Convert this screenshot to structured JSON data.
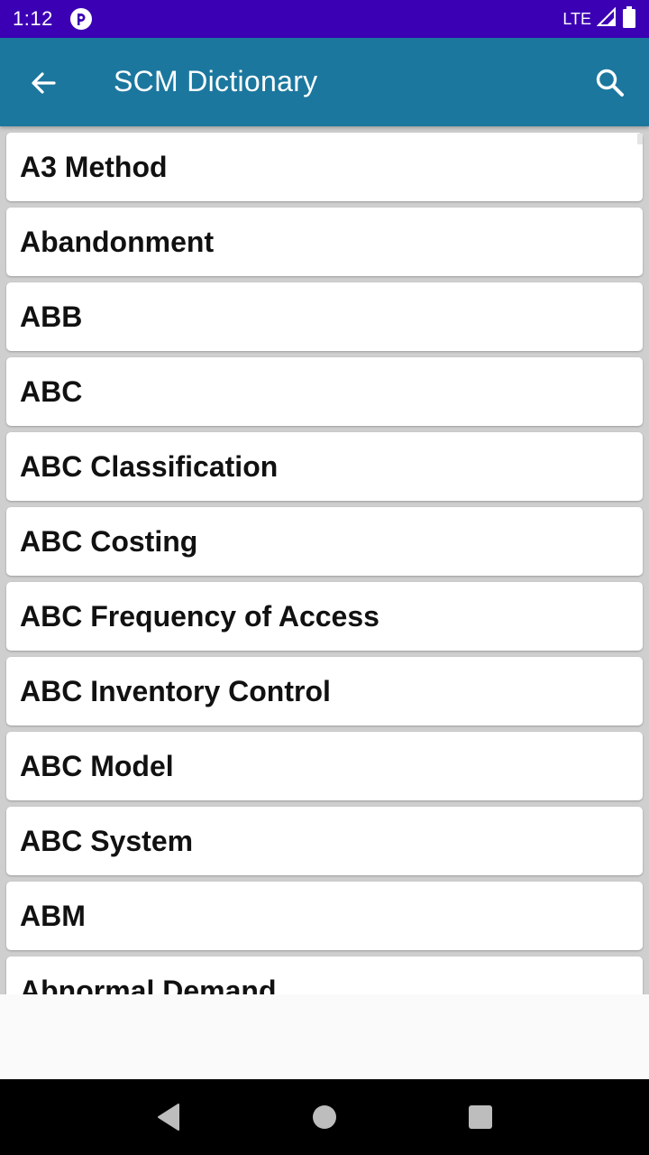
{
  "status_bar": {
    "time": "1:12",
    "network": "LTE",
    "icons": [
      "notification-app-icon",
      "signal-icon",
      "battery-icon"
    ]
  },
  "app_bar": {
    "title": "SCM Dictionary",
    "icons": [
      "arrow-back-icon",
      "search-icon"
    ]
  },
  "terms": [
    "A3 Method",
    "Abandonment",
    "ABB",
    "ABC",
    "ABC Classification",
    "ABC Costing",
    "ABC Frequency of Access",
    "ABC Inventory Control",
    "ABC Model",
    "ABC System",
    "ABM",
    "Abnormal Demand"
  ],
  "nav_bar": {
    "icons": [
      "back-triangle-icon",
      "home-circle-icon",
      "recents-square-icon"
    ]
  },
  "colors": {
    "status_bar": "#3c00b4",
    "app_bar": "#1b779e",
    "list_background": "#cfcfcf",
    "card": "#ffffff"
  }
}
